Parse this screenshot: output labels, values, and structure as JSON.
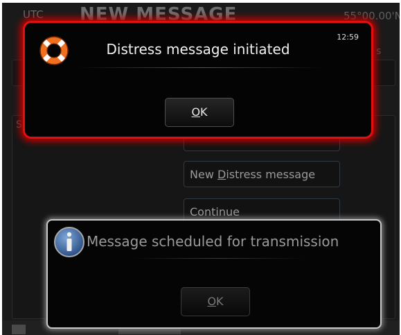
{
  "header": {
    "tz": "UTC",
    "title": "NEW MESSAGE",
    "position": "55°00.00'N"
  },
  "background": {
    "strip_text": "s",
    "panel_text": "S",
    "menu": [
      {
        "label": ""
      },
      {
        "label_pre": "New ",
        "label_key": "D",
        "label_post": "istress message"
      },
      {
        "label": "Continue"
      }
    ]
  },
  "distress_dialog": {
    "title": "Distress message initiated",
    "time": "12:59",
    "ok_key": "O",
    "ok_rest": "K",
    "colors": {
      "border": "#e01010",
      "glow": "#c40000"
    }
  },
  "scheduled_dialog": {
    "title": "Message scheduled for transmission",
    "ok_key": "O",
    "ok_rest": "K"
  },
  "icons": {
    "distress": "lifebuoy-icon",
    "scheduled": "info-icon"
  }
}
